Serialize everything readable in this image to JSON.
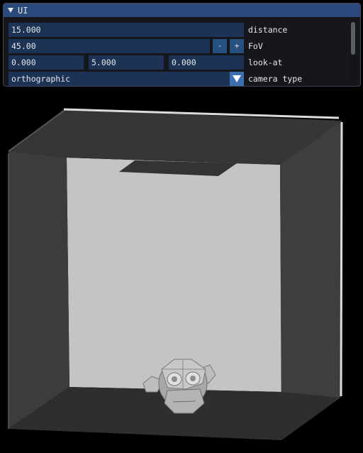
{
  "window": {
    "title": "UI"
  },
  "fields": {
    "distance": {
      "value": "15.000",
      "label": "distance"
    },
    "fov": {
      "value": "45.00",
      "label": "FoV",
      "minus": "-",
      "plus": "+"
    },
    "look_at": {
      "x": "0.000",
      "y": "5.000",
      "z": "0.000",
      "label": "look-at"
    },
    "camera_type": {
      "selected": "orthographic",
      "label": "camera type"
    }
  },
  "icons": {
    "collapse": "triangle-down-icon",
    "combo": "chevron-down-icon"
  },
  "colors": {
    "title_bar": "#294a7a",
    "field_bg": "#1c3356",
    "button_bg": "#25507f",
    "combo_arrow_bg": "#3b6fb0",
    "back_wall": "#c4c4c4",
    "side_walls": "#3c3c3c",
    "floor": "#2e2e2e",
    "background": "#000000"
  }
}
